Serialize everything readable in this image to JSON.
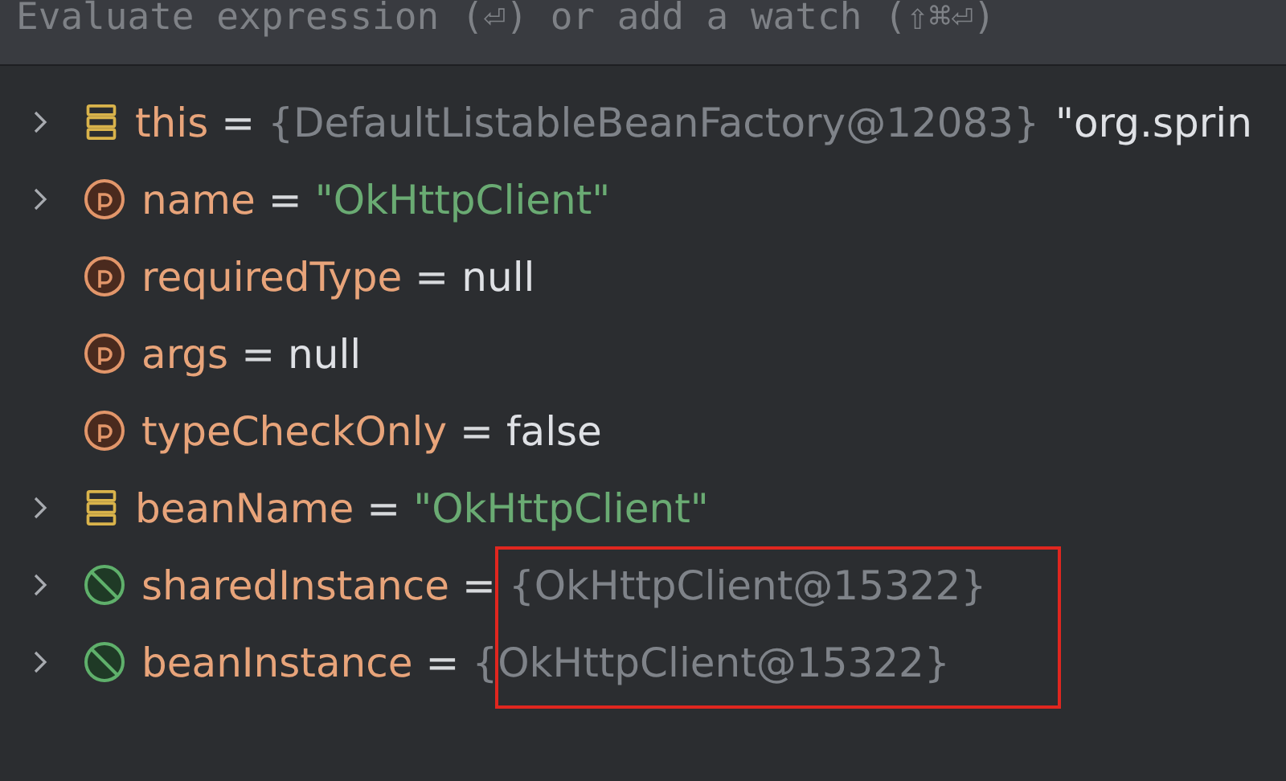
{
  "watch_field": {
    "placeholder": "Evaluate expression (⏎) or add a watch (⇧⌘⏎)"
  },
  "variables": [
    {
      "name": "this",
      "kind": "field",
      "expandable": true,
      "operator": "=",
      "value": {
        "kind": "object",
        "text": "{DefaultListableBeanFactory@12083}"
      },
      "extra": "\"org.sprin"
    },
    {
      "name": "name",
      "kind": "param",
      "expandable": true,
      "operator": "=",
      "value": {
        "kind": "string",
        "text": "\"OkHttpClient\""
      }
    },
    {
      "name": "requiredType",
      "kind": "param",
      "expandable": false,
      "operator": "=",
      "value": {
        "kind": "literal",
        "text": "null"
      }
    },
    {
      "name": "args",
      "kind": "param",
      "expandable": false,
      "operator": "=",
      "value": {
        "kind": "literal",
        "text": "null"
      }
    },
    {
      "name": "typeCheckOnly",
      "kind": "param",
      "expandable": false,
      "operator": "=",
      "value": {
        "kind": "literal",
        "text": "false"
      }
    },
    {
      "name": "beanName",
      "kind": "field",
      "expandable": true,
      "operator": "=",
      "value": {
        "kind": "string",
        "text": "\"OkHttpClient\""
      }
    },
    {
      "name": "sharedInstance",
      "kind": "null",
      "expandable": true,
      "operator": "=",
      "value": {
        "kind": "object",
        "text": "{OkHttpClient@15322}"
      }
    },
    {
      "name": "beanInstance",
      "kind": "null",
      "expandable": true,
      "operator": "=",
      "value": {
        "kind": "object",
        "text": "{OkHttpClient@15322}"
      }
    }
  ],
  "annotation": {
    "kind": "rectangle"
  }
}
